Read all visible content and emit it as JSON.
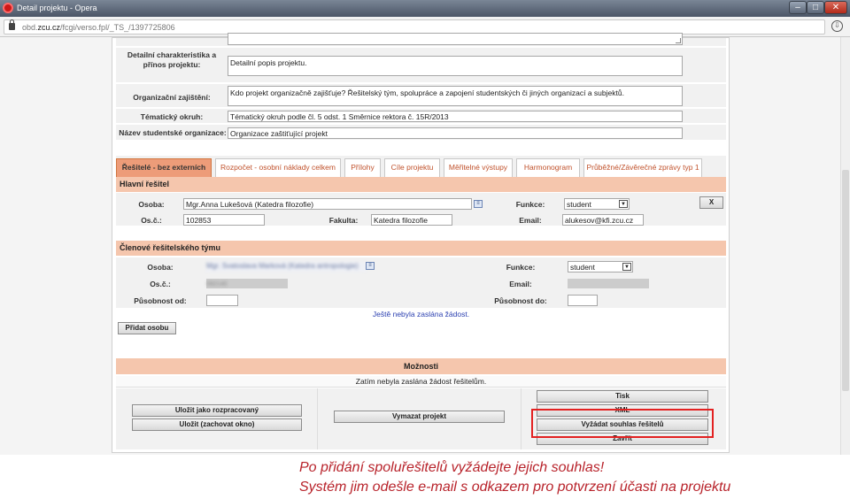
{
  "window": {
    "title": "Detail projektu - Opera",
    "min": "–",
    "max": "□",
    "close": "✕"
  },
  "address": {
    "prefix": "obd.",
    "domain": "zcu.cz",
    "path": "/fcgi/verso.fpl/_TS_/1397725806"
  },
  "details": {
    "char_label": "Detailní charakteristika a přínos projektu:",
    "char_value": "Detailní popis projektu.",
    "org_label": "Organizační zajištění:",
    "org_value": "Kdo projekt organizačně zajišťuje? Řešitelský tým, spolupráce a zapojení studentských či jiných organizací a subjektů.",
    "topic_label": "Tématický okruh:",
    "topic_value": "Tématický okruh podle čl. 5 odst. 1 Směrnice rektora č. 15R/2013",
    "student_org_label": "Název studentské organizace:",
    "student_org_value": "Organizace zaštiťující projekt"
  },
  "tabs": [
    {
      "label": "Řešitelé - bez externích"
    },
    {
      "label": "Rozpočet - osobní náklady celkem"
    },
    {
      "label": "Přílohy"
    },
    {
      "label": "Cíle projektu"
    },
    {
      "label": "Měřitelné výstupy"
    },
    {
      "label": "Harmonogram"
    },
    {
      "label": "Průběžné/Závěrečné zprávy typ 1"
    }
  ],
  "main_researcher": {
    "header": "Hlavní řešitel",
    "person_label": "Osoba:",
    "person_value": "Mgr.Anna Lukešová  (Katedra filozofie)",
    "function_label": "Funkce:",
    "function_value": "student",
    "remove_label": "X",
    "osc_label": "Os.č.:",
    "osc_value": "102853",
    "faculty_label": "Fakulta:",
    "faculty_value": "Katedra filozofie",
    "email_label": "Email:",
    "email_value": "alukesov@kfi.zcu.cz"
  },
  "team": {
    "header": "Členové řešitelského týmu",
    "person_label": "Osoba:",
    "person_value": "Mgr. Svatoslava Marková  (Katedra antropologie)",
    "function_label": "Funkce:",
    "function_value": "student",
    "osc_label": "Os.č.:",
    "osc_value": "092140",
    "email_label": "Email:",
    "from_label": "Působnost od:",
    "to_label": "Působnost do:",
    "status": "Ještě nebyla zaslána žádost.",
    "add_button": "Přidat osobu"
  },
  "options": {
    "header": "Možnosti",
    "status": "Zatím nebyla zaslána žádost řešitelům.",
    "save_draft": "Uložit jako rozpracovaný",
    "save_keep": "Uložit (zachovat okno)",
    "delete": "Vymazat projekt",
    "print": "Tisk",
    "xml": "XML",
    "request_consent": "Vyžádat souhlas řešitelů",
    "close": "Zavřít"
  },
  "caption": {
    "line1": "Po přidání spoluřešitelů vyžádejte jejich souhlas!",
    "line2": "Systém jim odešle e-mail s odkazem pro potvrzení účasti na projektu"
  },
  "colors": {
    "accent_tab": "#ed9c79",
    "section_header": "#f5c6ad",
    "highlight": "#e32121",
    "caption": "#b8232b"
  }
}
